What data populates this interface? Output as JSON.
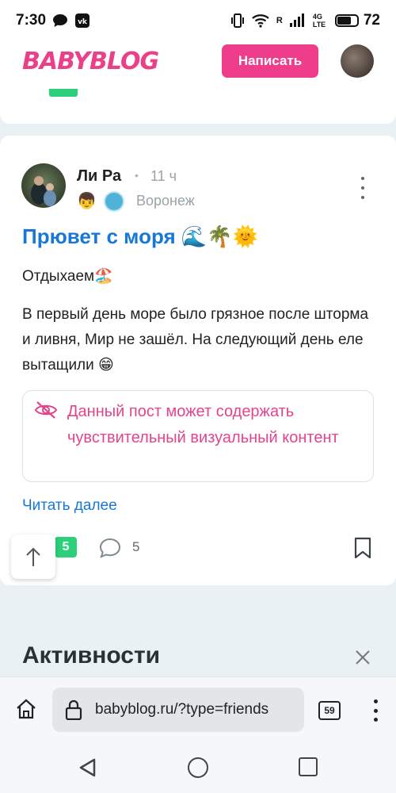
{
  "status_bar": {
    "time": "7:30",
    "battery": "72",
    "network": "4G LTE",
    "sim_mark": "R"
  },
  "header": {
    "logo": "BABYBLOG",
    "write_button": "Написать"
  },
  "post": {
    "author": "Ли Ра",
    "time_ago": "11 ч",
    "city": "Воронеж",
    "title": "Прювет с моря 🌊🌴🌞",
    "subtitle": "Отдыхаем🏖️",
    "body": "В первый день море было грязное после шторма и ливня, Мир не зашёл. На следующий день еле вытащили 😁",
    "sensitive_notice": "Данный пост может содержать чувствительный визуальный контент",
    "read_more": "Читать далее",
    "likes": "5",
    "comments": "5",
    "badge_emoji": "👦"
  },
  "activities": {
    "title": "Активности"
  },
  "browser": {
    "url": "babyblog.ru/?type=friends",
    "tab_count": "59"
  },
  "colors": {
    "brand_pink": "#ee3d8a",
    "link_blue": "#1778d8",
    "like_green": "#2ccf7a"
  }
}
